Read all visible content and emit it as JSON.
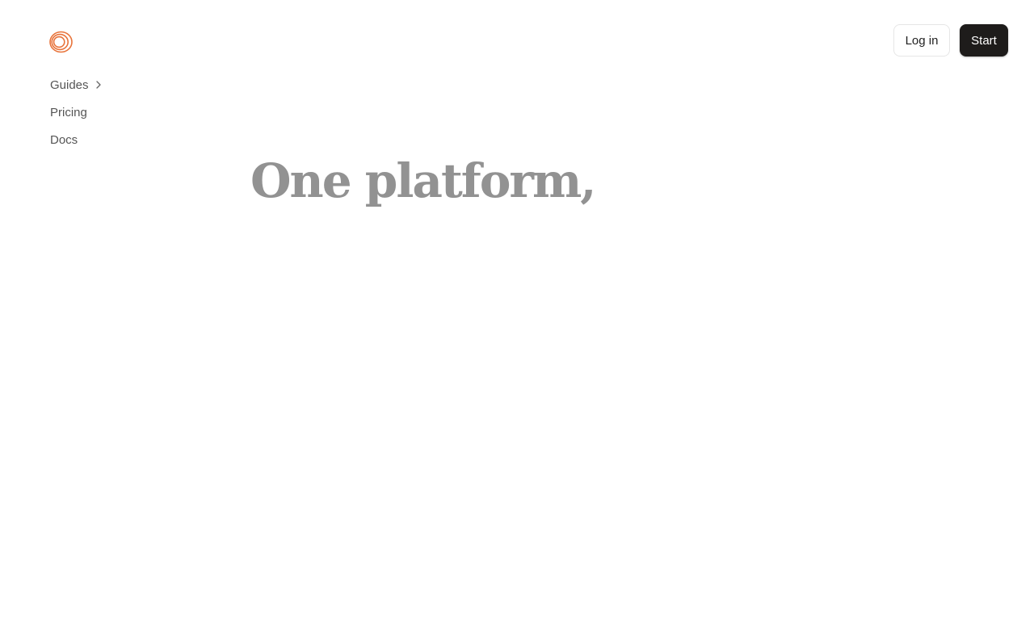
{
  "brand": {
    "logo_icon": "concentric-rings-logo-icon",
    "accent_color": "#e8733a"
  },
  "nav": {
    "items": [
      {
        "label": "Guides",
        "icon": "chevron-right-icon"
      },
      {
        "label": "Pricing"
      },
      {
        "label": "Docs"
      }
    ]
  },
  "header": {
    "login_label": "Log in",
    "start_label": "Start"
  },
  "hero": {
    "title": "One platform,"
  }
}
